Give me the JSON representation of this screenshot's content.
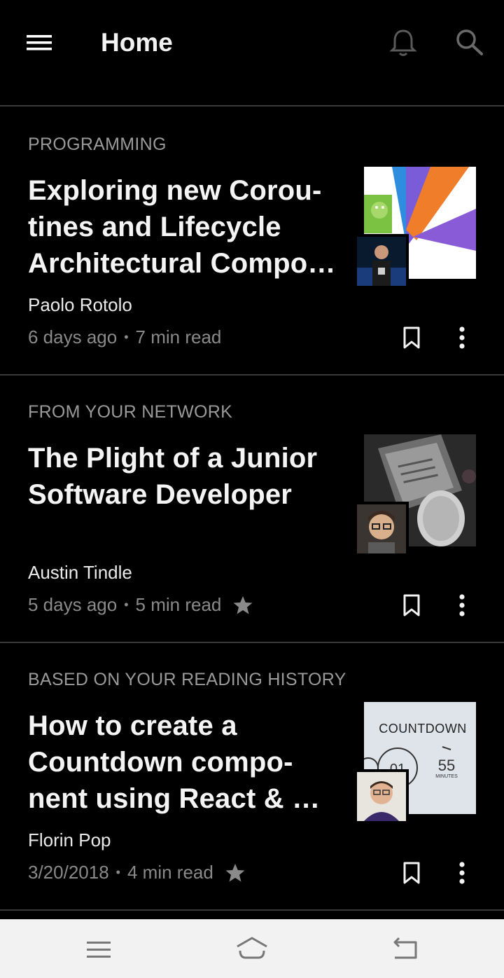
{
  "app_bar": {
    "title": "Home",
    "icons": [
      "menu-icon",
      "bell-icon",
      "search-icon"
    ]
  },
  "articles": [
    {
      "category": "PROGRAMMING",
      "title": "Exploring new Corou-tines and Lifecycle Architectural Compo…",
      "author": "Paolo Rotolo",
      "date": "6 days ago",
      "read_time": "7 min read",
      "starred": false
    },
    {
      "category": "FROM YOUR NETWORK",
      "title": "The Plight of a Junior Software Developer",
      "author": "Austin Tindle",
      "date": "5 days ago",
      "read_time": "5 min read",
      "starred": true
    },
    {
      "category": "BASED ON YOUR READING HISTORY",
      "title": "How to create a Countdown compo-nent using React & …",
      "author": "Florin Pop",
      "date": "3/20/2018",
      "read_time": "4 min read",
      "starred": true,
      "thumbnail_text": {
        "heading": "COUNTDOWN",
        "left_number": "01",
        "right_number": "55",
        "right_unit": "MINUTES"
      }
    }
  ],
  "system_nav": {
    "icons": [
      "recents-icon",
      "home-icon",
      "back-icon"
    ],
    "background": "#f2f2f2"
  },
  "colors": {
    "background": "#000000",
    "divider": "#3a3a3a",
    "category": "#9a9a9a",
    "meta": "#8a8a8a"
  }
}
